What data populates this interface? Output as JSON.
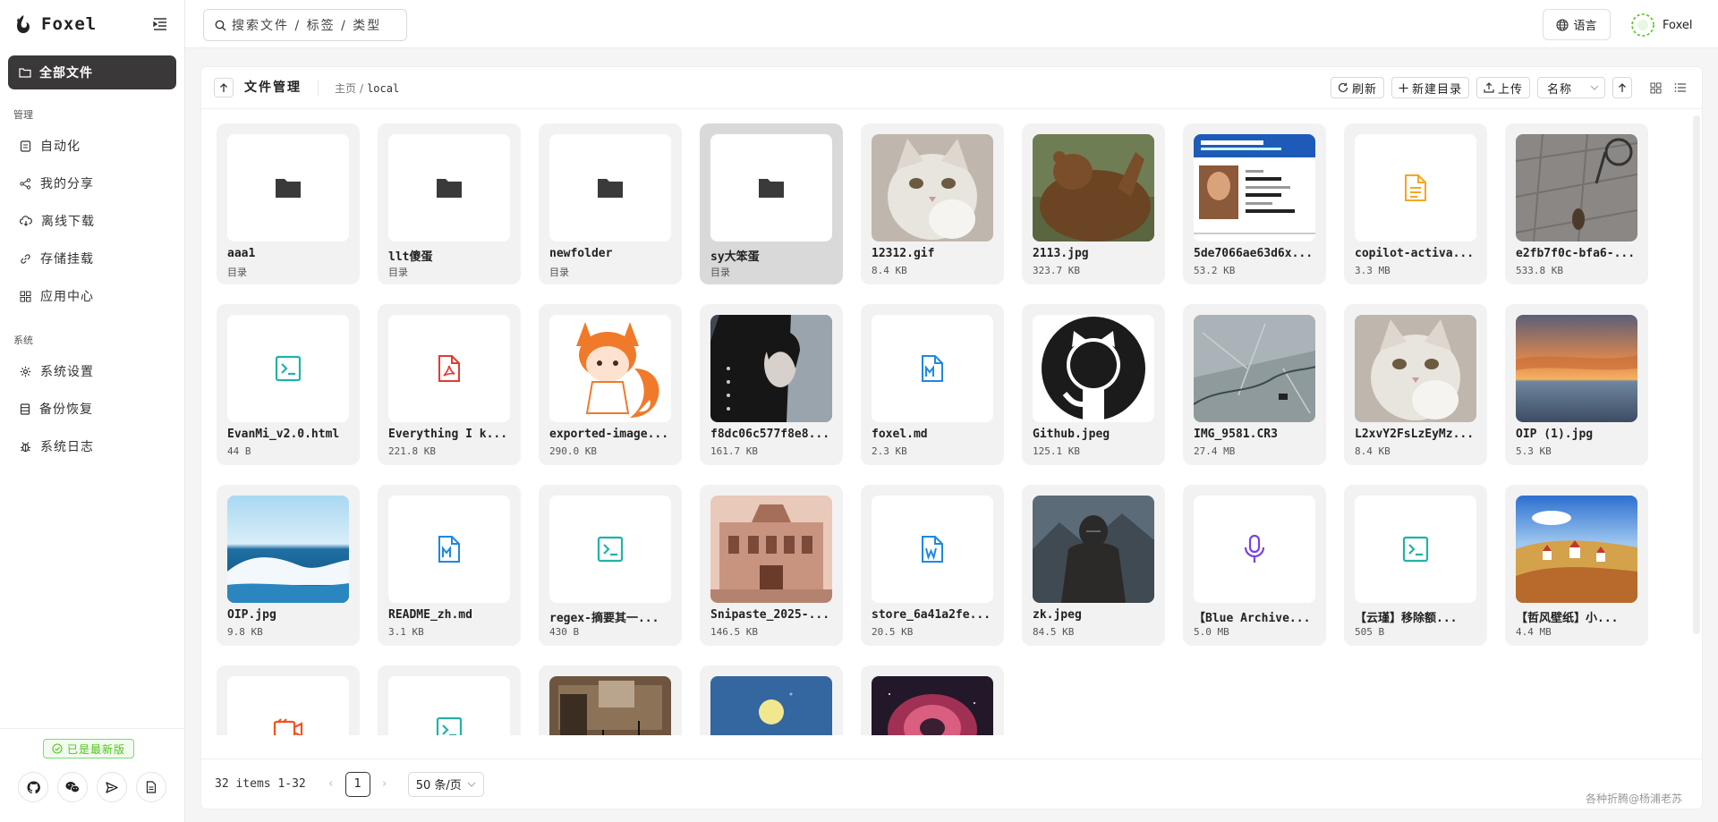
{
  "app": {
    "name": "Foxel"
  },
  "sidebar": {
    "active_item": "全部文件",
    "groups": [
      {
        "title": "管理",
        "items": [
          {
            "label": "自动化",
            "icon": "robot-icon"
          },
          {
            "label": "我的分享",
            "icon": "share-icon"
          },
          {
            "label": "离线下载",
            "icon": "cloud-download-icon"
          },
          {
            "label": "存储挂载",
            "icon": "link-icon"
          },
          {
            "label": "应用中心",
            "icon": "apps-icon"
          }
        ]
      },
      {
        "title": "系统",
        "items": [
          {
            "label": "系统设置",
            "icon": "gear-icon"
          },
          {
            "label": "备份恢复",
            "icon": "database-icon"
          },
          {
            "label": "系统日志",
            "icon": "bug-icon"
          }
        ]
      }
    ],
    "version_badge": "已是最新版"
  },
  "topbar": {
    "search_placeholder": "搜索文件 / 标签 / 类型",
    "language_label": "语言",
    "user_name": "Foxel"
  },
  "file_manager": {
    "title": "文件管理",
    "breadcrumb": {
      "home": "主页",
      "current": "local"
    },
    "toolbar": {
      "refresh_label": "刷新",
      "new_folder_label": "新建目录",
      "upload_label": "上传",
      "sort_by": "名称"
    },
    "files": [
      {
        "name": "aaa1",
        "meta": "目录",
        "kind": "folder"
      },
      {
        "name": "llt傻蛋",
        "meta": "目录",
        "kind": "folder"
      },
      {
        "name": "newfolder",
        "meta": "目录",
        "kind": "folder"
      },
      {
        "name": "sy大笨蛋",
        "meta": "目录",
        "kind": "folder",
        "selected": true
      },
      {
        "name": "12312.gif",
        "meta": "8.4 KB",
        "kind": "image",
        "art": "cat"
      },
      {
        "name": "2113.jpg",
        "meta": "323.7 KB",
        "kind": "image",
        "art": "bear"
      },
      {
        "name": "5de7066ae63d6x...",
        "meta": "53.2 KB",
        "kind": "image",
        "art": "card"
      },
      {
        "name": "copilot-activa...",
        "meta": "3.3 MB",
        "kind": "doc",
        "icon": "file-text-icon",
        "color": "#f5a623"
      },
      {
        "name": "e2fb7f0c-bfa6-...",
        "meta": "533.8 KB",
        "kind": "image",
        "art": "street"
      },
      {
        "name": "EvanMi_v2.0.html",
        "meta": "44 B",
        "kind": "doc",
        "icon": "code-file-icon",
        "color": "#20b2aa"
      },
      {
        "name": "Everything I k...",
        "meta": "221.8 KB",
        "kind": "doc",
        "icon": "pdf-file-icon",
        "color": "#e53935"
      },
      {
        "name": "exported-image...",
        "meta": "290.0 KB",
        "kind": "image",
        "art": "foxgirl"
      },
      {
        "name": "f8dc06c577f8e8...",
        "meta": "161.7 KB",
        "kind": "image",
        "art": "portrait"
      },
      {
        "name": "foxel.md",
        "meta": "2.3 KB",
        "kind": "doc",
        "icon": "markdown-file-icon",
        "color": "#1e88e5"
      },
      {
        "name": "Github.jpeg",
        "meta": "125.1 KB",
        "kind": "image",
        "art": "github"
      },
      {
        "name": "IMG_9581.CR3",
        "meta": "27.4 MB",
        "kind": "image",
        "art": "ground"
      },
      {
        "name": "L2xvY2FsLzEyMz...",
        "meta": "8.4 KB",
        "kind": "image",
        "art": "cat"
      },
      {
        "name": "OIP (1).jpg",
        "meta": "5.3 KB",
        "kind": "image",
        "art": "sunset"
      },
      {
        "name": "OIP.jpg",
        "meta": "9.8 KB",
        "kind": "image",
        "art": "wave"
      },
      {
        "name": "README_zh.md",
        "meta": "3.1 KB",
        "kind": "doc",
        "icon": "markdown-file-icon",
        "color": "#1e88e5"
      },
      {
        "name": "regex-摘要其一...",
        "meta": "430 B",
        "kind": "doc",
        "icon": "code-file-icon",
        "color": "#20b2aa"
      },
      {
        "name": "Snipaste_2025-...",
        "meta": "146.5 KB",
        "kind": "image",
        "art": "building"
      },
      {
        "name": "store_6a41a2fe...",
        "meta": "20.5 KB",
        "kind": "doc",
        "icon": "word-file-icon",
        "color": "#1e88e5"
      },
      {
        "name": "zk.jpeg",
        "meta": "84.5 KB",
        "kind": "image",
        "art": "knight"
      },
      {
        "name": "【Blue Archive...",
        "meta": "5.0 MB",
        "kind": "doc",
        "icon": "microphone-icon",
        "color": "#7b3fe4"
      },
      {
        "name": "【云瑾】移除额...",
        "meta": "505 B",
        "kind": "doc",
        "icon": "code-file-icon",
        "color": "#20b2aa"
      },
      {
        "name": "【哲风壁纸】小...",
        "meta": "4.4 MB",
        "kind": "image",
        "art": "village"
      },
      {
        "name": "",
        "meta": "",
        "kind": "doc",
        "icon": "video-file-icon",
        "color": "#f4511e"
      },
      {
        "name": "",
        "meta": "",
        "kind": "doc",
        "icon": "code-file-icon",
        "color": "#20b2aa"
      },
      {
        "name": "",
        "meta": "",
        "kind": "image",
        "art": "studio"
      },
      {
        "name": "",
        "meta": "",
        "kind": "image",
        "art": "moon"
      },
      {
        "name": "",
        "meta": "",
        "kind": "image",
        "art": "nebula"
      }
    ],
    "pagination": {
      "total_label": "32 items 1-32",
      "current_page": "1",
      "page_size": "50 条/页"
    },
    "watermark": "各种折腾@杨浦老苏"
  }
}
